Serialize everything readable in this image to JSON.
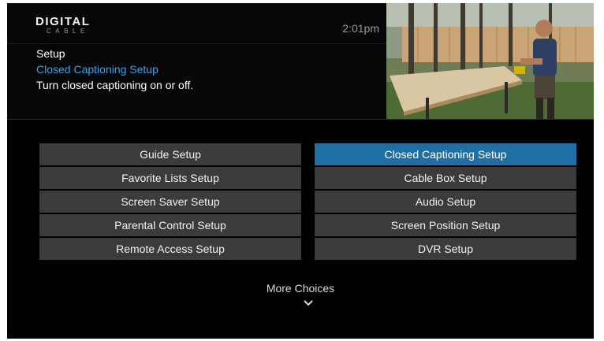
{
  "logo": {
    "main": "DIGITAL",
    "sub": "CABLE"
  },
  "clock": "2:01pm",
  "breadcrumb": {
    "section": "Setup",
    "current": "Closed Captioning Setup",
    "description": "Turn closed captioning on or off."
  },
  "menu": {
    "left": [
      "Guide Setup",
      "Favorite Lists Setup",
      "Screen Saver Setup",
      "Parental Control Setup",
      "Remote Access Setup"
    ],
    "right": [
      "Closed Captioning Setup",
      "Cable Box Setup",
      "Audio Setup",
      "Screen Position Setup",
      "DVR Setup"
    ],
    "selected": "Closed Captioning Setup"
  },
  "more_choices": "More Choices",
  "icons": {
    "more": "chevron-down-icon"
  },
  "colors": {
    "accent_text": "#3da2e8",
    "selected_bg": "#1f6fa6",
    "button_bg": "#3b3b3b",
    "background": "#000000"
  }
}
